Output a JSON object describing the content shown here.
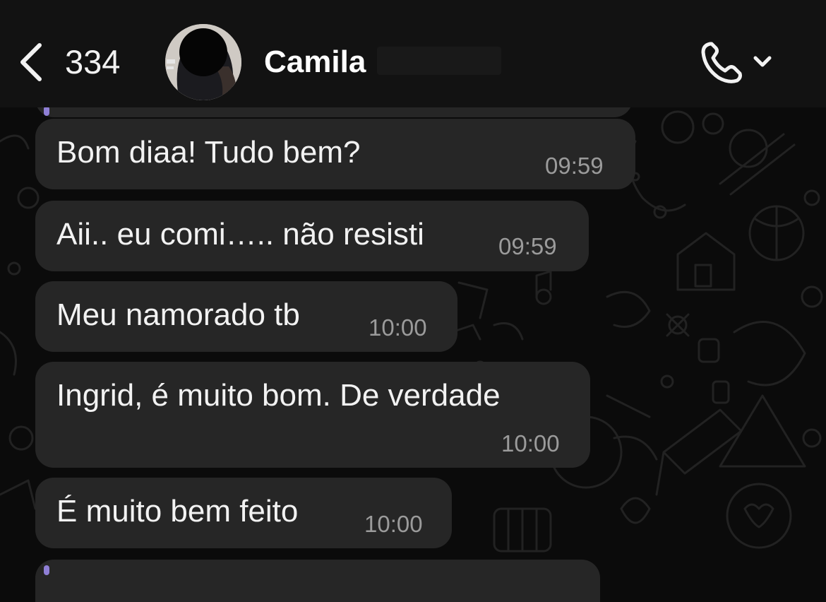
{
  "header": {
    "back_count": "334",
    "contact_name": "Camila"
  },
  "messages": [
    {
      "text": "Bom diaa! Tudo bem?",
      "time": "09:59"
    },
    {
      "text": "Aii.. eu comi….. não resisti",
      "time": "09:59"
    },
    {
      "text": "Meu namorado tb",
      "time": "10:00"
    },
    {
      "text": "Ingrid, é muito bom. De verdade",
      "time": "10:00"
    },
    {
      "text": "É muito bem feito",
      "time": "10:00"
    }
  ],
  "icons": {
    "back": "chevron-left-icon",
    "call": "phone-icon",
    "call_menu": "chevron-down-icon"
  },
  "colors": {
    "background": "#0b0b0b",
    "header": "#121212",
    "bubble": "#262626",
    "text": "#f2f2f2",
    "timestamp": "#9b9b9b",
    "reply_accent": "#8f7fd6"
  }
}
